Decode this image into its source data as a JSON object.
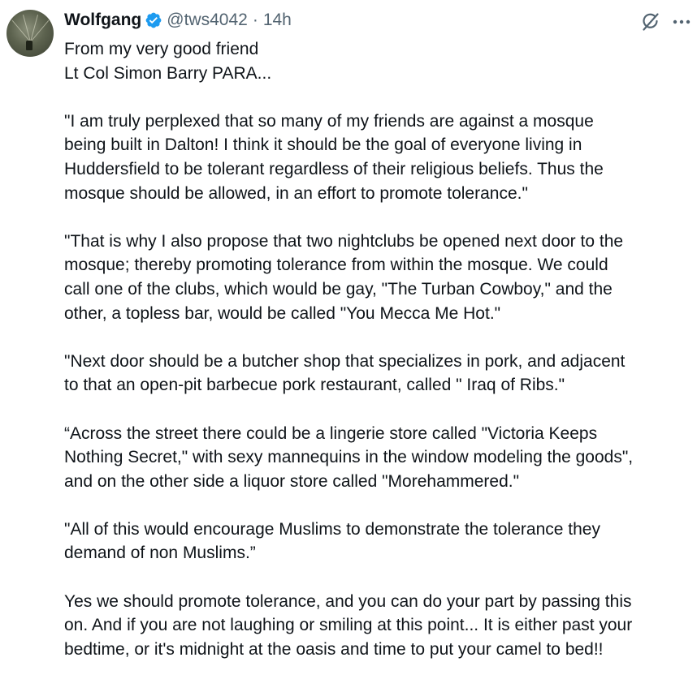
{
  "tweet": {
    "author": {
      "name": "Wolfgang",
      "handle": "@tws4042",
      "separator": "·",
      "time": "14h",
      "verified_color": "#1d9bf0"
    },
    "icons": {
      "avatar": "profile-photo",
      "verified": "verified-badge-icon",
      "grok": "grok-icon",
      "more": "more-options-icon"
    },
    "paragraphs": [
      {
        "lines": [
          "From my very good friend",
          "Lt Col Simon Barry PARA..."
        ]
      },
      {
        "lines": [
          "\"I am truly perplexed that so many of my friends are against a mosque",
          "being built in Dalton! I think it should be the goal of everyone living in",
          "Huddersfield to be tolerant regardless of their religious beliefs. Thus the",
          "mosque should be allowed, in an effort to promote tolerance.\""
        ]
      },
      {
        "lines": [
          "\"That is why I also propose that two nightclubs be opened next door to the",
          "mosque; thereby promoting tolerance from within the mosque. We could",
          "call one of the clubs, which would be gay, \"The Turban Cowboy,\" and the",
          "other, a topless bar, would be called \"You Mecca Me Hot.\""
        ]
      },
      {
        "lines": [
          "\"Next door should be a butcher shop that specializes in pork, and adjacent",
          "to that an open-pit barbecue pork restaurant, called \" Iraq of Ribs.\""
        ]
      },
      {
        "lines": [
          "“Across the street there could be a lingerie store called \"Victoria Keeps",
          "Nothing Secret,\" with sexy mannequins in the window modeling the goods\",",
          "and on the other side a liquor store called \"Morehammered.\""
        ]
      },
      {
        "lines": [
          "\"All of this would encourage Muslims to demonstrate the tolerance they",
          "demand of non Muslims.”"
        ]
      },
      {
        "lines": [
          "Yes we should promote tolerance, and you can do your part by passing this",
          "on. And if you are not laughing or smiling at this point... It is either past your",
          "bedtime, or it's midnight at the oasis and time to put your camel to bed!!"
        ]
      }
    ]
  }
}
